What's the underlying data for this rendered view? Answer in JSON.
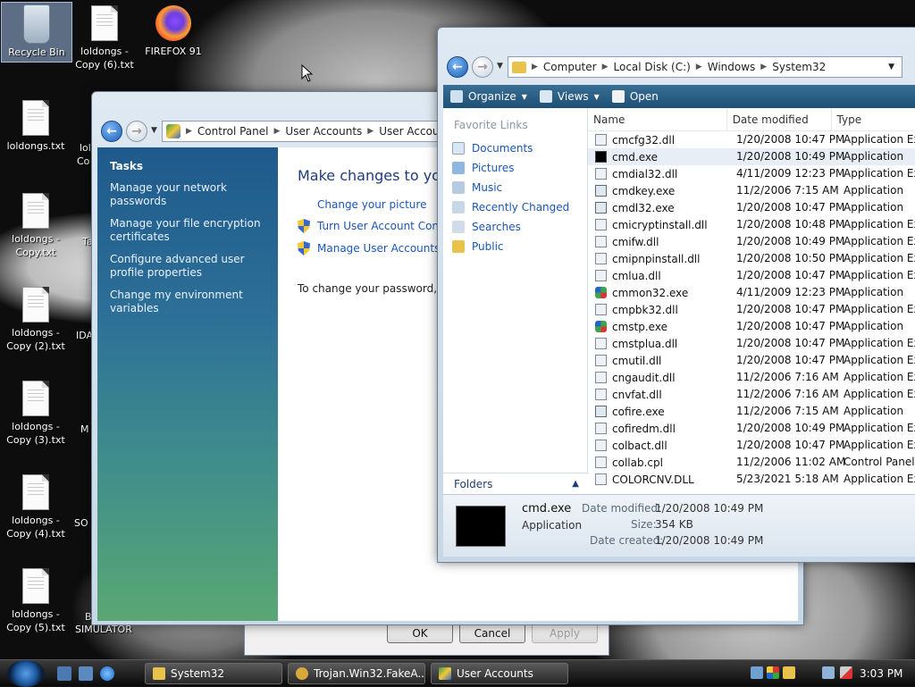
{
  "desktop": {
    "icons": [
      {
        "label": "Recycle Bin"
      },
      {
        "label": "loldongs - Copy (6).txt"
      },
      {
        "label": "FIREFOX 91"
      },
      {
        "label": "loldongs.txt"
      },
      {
        "label": "loldongs - Copy.txt"
      },
      {
        "label": "loldongs - Copy (2).txt"
      },
      {
        "label": "loldongs - Copy (3).txt"
      },
      {
        "label": "loldongs - Copy (4).txt"
      },
      {
        "label": "loldongs - Copy (5).txt"
      }
    ],
    "partial_labels": [
      "lol",
      "Co",
      "Ta",
      "IDA",
      "M",
      "SO",
      "B",
      "SIMULATOR"
    ]
  },
  "control_panel": {
    "breadcrumb": [
      "Control Panel",
      "User Accounts",
      "User Accounts"
    ],
    "tasks_title": "Tasks",
    "tasks": [
      "Manage your network passwords",
      "Manage your file encryption certificates",
      "Configure advanced user profile properties",
      "Change my environment variables"
    ],
    "heading": "Make changes to your",
    "links": [
      "Change your picture",
      "Turn User Account Contro",
      "Manage User Accounts"
    ],
    "note": "To change your password, pre"
  },
  "dialog": {
    "ok": "OK",
    "cancel": "Cancel",
    "apply": "Apply"
  },
  "explorer": {
    "breadcrumb": [
      "Computer",
      "Local Disk (C:)",
      "Windows",
      "System32"
    ],
    "toolbar": {
      "organize": "Organize",
      "views": "Views",
      "open": "Open"
    },
    "favorites_header": "Favorite Links",
    "favorites": [
      "Documents",
      "Pictures",
      "Music",
      "Recently Changed",
      "Searches",
      "Public"
    ],
    "folders_label": "Folders",
    "columns": [
      "Name",
      "Date modified",
      "Type"
    ],
    "files": [
      {
        "name": "cmcfg32.dll",
        "date": "1/20/2008 10:47 PM",
        "type": "Application Exte",
        "icon": "dll"
      },
      {
        "name": "cmd.exe",
        "date": "1/20/2008 10:49 PM",
        "type": "Application",
        "icon": "cmd"
      },
      {
        "name": "cmdial32.dll",
        "date": "4/11/2009 12:23 PM",
        "type": "Application Exte",
        "icon": "dll"
      },
      {
        "name": "cmdkey.exe",
        "date": "11/2/2006 7:15 AM",
        "type": "Application",
        "icon": "exe"
      },
      {
        "name": "cmdl32.exe",
        "date": "1/20/2008 10:47 PM",
        "type": "Application",
        "icon": "exe"
      },
      {
        "name": "cmicryptinstall.dll",
        "date": "1/20/2008 10:48 PM",
        "type": "Application Exte",
        "icon": "dll"
      },
      {
        "name": "cmifw.dll",
        "date": "1/20/2008 10:49 PM",
        "type": "Application Exte",
        "icon": "dll"
      },
      {
        "name": "cmipnpinstall.dll",
        "date": "1/20/2008 10:50 PM",
        "type": "Application Exte",
        "icon": "dll"
      },
      {
        "name": "cmlua.dll",
        "date": "1/20/2008 10:47 PM",
        "type": "Application Exte",
        "icon": "dll"
      },
      {
        "name": "cmmon32.exe",
        "date": "4/11/2009 12:23 PM",
        "type": "Application",
        "icon": "gear"
      },
      {
        "name": "cmpbk32.dll",
        "date": "1/20/2008 10:47 PM",
        "type": "Application Exte",
        "icon": "dll"
      },
      {
        "name": "cmstp.exe",
        "date": "1/20/2008 10:47 PM",
        "type": "Application",
        "icon": "gear"
      },
      {
        "name": "cmstplua.dll",
        "date": "1/20/2008 10:47 PM",
        "type": "Application Exte",
        "icon": "dll"
      },
      {
        "name": "cmutil.dll",
        "date": "1/20/2008 10:47 PM",
        "type": "Application Exte",
        "icon": "dll"
      },
      {
        "name": "cngaudit.dll",
        "date": "11/2/2006 7:16 AM",
        "type": "Application Exte",
        "icon": "dll"
      },
      {
        "name": "cnvfat.dll",
        "date": "11/2/2006 7:16 AM",
        "type": "Application Exte",
        "icon": "dll"
      },
      {
        "name": "cofire.exe",
        "date": "11/2/2006 7:15 AM",
        "type": "Application",
        "icon": "exe"
      },
      {
        "name": "cofiredm.dll",
        "date": "1/20/2008 10:49 PM",
        "type": "Application Exte",
        "icon": "dll"
      },
      {
        "name": "colbact.dll",
        "date": "1/20/2008 10:47 PM",
        "type": "Application Exte",
        "icon": "dll"
      },
      {
        "name": "collab.cpl",
        "date": "11/2/2006 11:02 AM",
        "type": "Control Panel It",
        "icon": "dll"
      },
      {
        "name": "COLORCNV.DLL",
        "date": "5/23/2021 5:18 AM",
        "type": "Application Exte",
        "icon": "dll"
      }
    ],
    "details": {
      "name": "cmd.exe",
      "type": "Application",
      "modified_label": "Date modified:",
      "modified": "1/20/2008 10:49 PM",
      "size_label": "Size:",
      "size": "354 KB",
      "created_label": "Date created:",
      "created": "1/20/2008 10:49 PM"
    }
  },
  "taskbar": {
    "buttons": [
      "System32",
      "Trojan.Win32.FakeA...",
      "User Accounts"
    ],
    "clock": "3:03 PM"
  }
}
